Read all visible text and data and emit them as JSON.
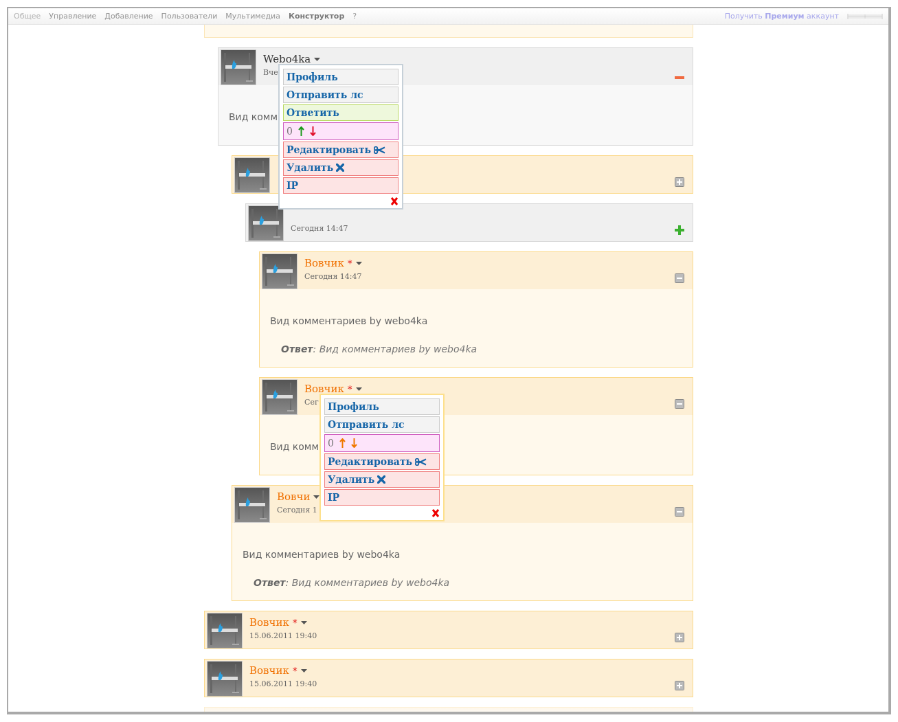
{
  "nav": {
    "items": [
      {
        "label": "Общее",
        "selected": false,
        "disabled": true
      },
      {
        "label": "Управление",
        "selected": false,
        "disabled": false
      },
      {
        "label": "Добавление",
        "selected": false,
        "disabled": false
      },
      {
        "label": "Пользователи",
        "selected": false,
        "disabled": false
      },
      {
        "label": "Мультимедиа",
        "selected": false,
        "disabled": false
      },
      {
        "label": "Конструктор",
        "selected": true,
        "disabled": false
      },
      {
        "label": "?",
        "selected": false,
        "disabled": false
      }
    ],
    "premium_link": "Получить **Премиум** аккаунт"
  },
  "comments": [
    {
      "kind": "tail",
      "children": [
        {
          "kind": "admin",
          "name": "Webo4ka",
          "date": "Вче",
          "expanded": true,
          "text": "Вид комм",
          "menu": {
            "items": [
              {
                "kind": "link",
                "label": "Профиль"
              },
              {
                "kind": "link",
                "label": "Отправить лс"
              },
              {
                "kind": "reply",
                "label": "Ответить"
              },
              {
                "kind": "rating",
                "label": "0",
                "arrows": [
                  {
                    "kind": "up",
                    "color": "#1a9a1a"
                  },
                  {
                    "kind": "down",
                    "color": "#e0102a"
                  }
                ]
              },
              {
                "kind": "edit",
                "label": "Редактировать"
              },
              {
                "kind": "delete",
                "label": "Удалить"
              },
              {
                "kind": "danger",
                "label": "IP"
              }
            ]
          },
          "children": [
            {
              "kind": "user",
              "expanded": false,
              "children": [
                {
                  "kind": "admin",
                  "date": "Сегодня 14:47",
                  "expanded": false,
                  "children": [
                    {
                      "kind": "user",
                      "name": "Вовчик",
                      "star": "*",
                      "date": "Сегодня 14:47",
                      "expanded": true,
                      "text": "Вид комментариев by webo4ka",
                      "reply": "**Ответ**: Вид комментариев by webo4ka"
                    },
                    {
                      "kind": "user",
                      "name": "Вовчик",
                      "star": "*",
                      "date": "Сег",
                      "expanded": true,
                      "text": "Вид комм",
                      "menu": {
                        "items": [
                          {
                            "kind": "link",
                            "label": "Профиль"
                          },
                          {
                            "kind": "link",
                            "label": "Отправить лс"
                          },
                          {
                            "kind": "rating",
                            "label": "0",
                            "arrows": [
                              {
                                "kind": "up",
                                "color": "#f07800"
                              },
                              {
                                "kind": "down",
                                "color": "#f07800"
                              }
                            ]
                          },
                          {
                            "kind": "edit",
                            "label": "Редактировать"
                          },
                          {
                            "kind": "delete",
                            "label": "Удалить"
                          },
                          {
                            "kind": "danger",
                            "label": "IP"
                          }
                        ]
                      }
                    }
                  ]
                }
              ]
            },
            {
              "kind": "user",
              "name": "Вовчи",
              "date": "Сегодня 1",
              "expanded": true,
              "text": "Вид комментариев by webo4ka",
              "reply": "**Ответ**: Вид комментариев by webo4ka"
            }
          ]
        }
      ]
    },
    {
      "kind": "user",
      "name": "Вовчик",
      "star": "*",
      "date": "15.06.2011 19:40",
      "expanded": false
    },
    {
      "kind": "user",
      "name": "Вовчик",
      "star": "*",
      "date": "15.06.2011 19:40",
      "expanded": false
    },
    {
      "kind": "head"
    }
  ]
}
